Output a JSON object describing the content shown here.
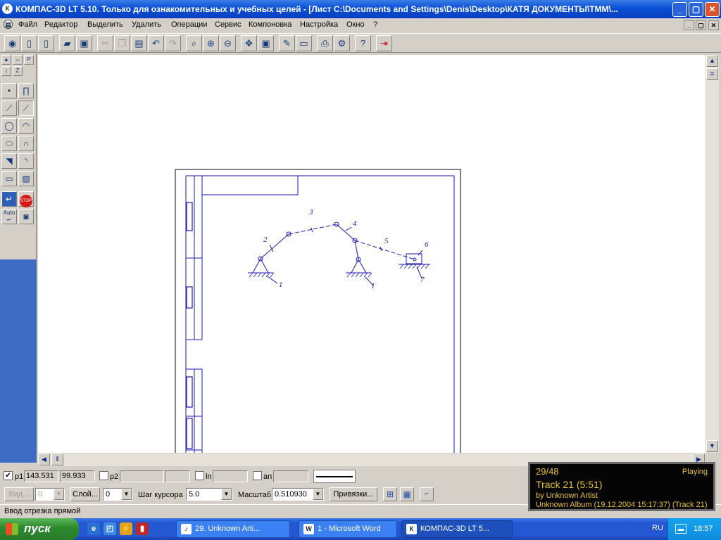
{
  "window": {
    "title": "КОМПАС-3D LT 5.10. Только для ознакомительных и учебных целей - [Лист C:\\Documents and Settings\\Denis\\Desktop\\КАТЯ ДОКУМЕНТЫ\\ТММ\\...",
    "app_icon": "kompas-icon",
    "minimize": "_",
    "maximize": "▢",
    "close": "✕"
  },
  "menu": {
    "items": [
      "Файл",
      "Редактор",
      "Выделить",
      "Удалить",
      "Операции",
      "Сервис",
      "Компоновка",
      "Настройка",
      "Окно",
      "?"
    ],
    "doc_buttons": [
      "_",
      "▢",
      "✕"
    ]
  },
  "toolbar": {
    "icons": [
      "save-icon",
      "new-document-icon",
      "new-sheet-icon",
      "open-folder-icon",
      "floppy-icon",
      "cut-icon",
      "copy-icon",
      "paste-icon",
      "undo-icon",
      "redo-icon",
      "zoom-window-icon",
      "zoom-in-icon",
      "zoom-out-icon",
      "pan-icon",
      "zoom-fit-icon",
      "properties-icon",
      "sheet-icon",
      "print-preview-icon",
      "print-icon",
      "help-icon",
      "exit-icon"
    ]
  },
  "drawing": {
    "labels": [
      "1",
      "2",
      "3",
      "4",
      "5",
      "6",
      "7",
      "1"
    ]
  },
  "params": {
    "p1_label": "p1",
    "p1_x": "143.531",
    "p1_y": "99.933",
    "p2_label": "p2",
    "ln_label": "ln",
    "an_label": "an"
  },
  "controls": {
    "vid": "Вид...",
    "vid_value": "0",
    "layer": "Слой...",
    "layer_value": "0",
    "step_label": "Шаг курсора",
    "step_value": "5.0",
    "scale_label": "Масштаб",
    "scale_value": "0.510930",
    "snaps": "Привязки..."
  },
  "status": {
    "text": "Ввод отрезка прямой"
  },
  "player": {
    "count": "29/48",
    "state": "Playing",
    "track": "Track 21 (5:51)",
    "artist": "by Unknown Artist",
    "album": "Unknown Album (19.12.2004 15:17:37) (Track 21)"
  },
  "taskbar": {
    "start": "пуск",
    "tasks": [
      "29. Unknown Arti...",
      "1 - Microsoft Word",
      "КОМПАС-3D LT 5..."
    ],
    "lang": "RU",
    "clock": "18:57"
  },
  "colors": {
    "drawing_line": "#1a1ab4",
    "player_text": "#e8c22a"
  }
}
